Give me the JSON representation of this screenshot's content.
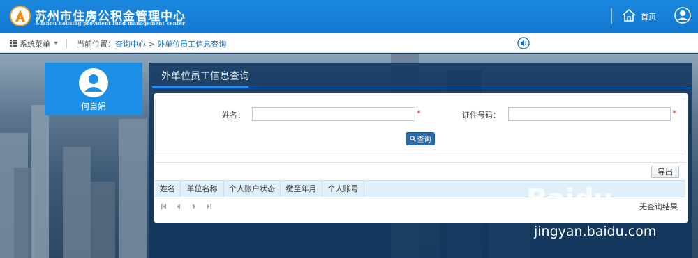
{
  "header": {
    "title": "苏州市住房公积金管理中心",
    "subtitle": "Suzhou housing provident fund management center",
    "home_label": "首页",
    "colors": {
      "header_bg": "#1378cf",
      "accent": "#1e90ff"
    }
  },
  "toolbar": {
    "menu_label": "系统菜单",
    "breadcrumb_prefix": "当前位置：",
    "breadcrumb_link": "查询中心",
    "breadcrumb_sep": " > ",
    "breadcrumb_current": "外单位员工信息查询"
  },
  "user": {
    "name": "何自娟"
  },
  "main": {
    "title": "外单位员工信息查询",
    "form": {
      "name_label": "姓名：",
      "name_value": "",
      "id_label": "证件号码：",
      "id_value": "",
      "required_mark": "*",
      "query_label": "查询"
    },
    "grid": {
      "export_label": "导出",
      "columns": [
        "姓名",
        "单位名称",
        "个人账户状态",
        "缴至年月",
        "个人账号"
      ],
      "empty_text": "无查询结果"
    }
  },
  "watermark": {
    "logo": "Baidu",
    "url": "jingyan.baidu.com"
  }
}
